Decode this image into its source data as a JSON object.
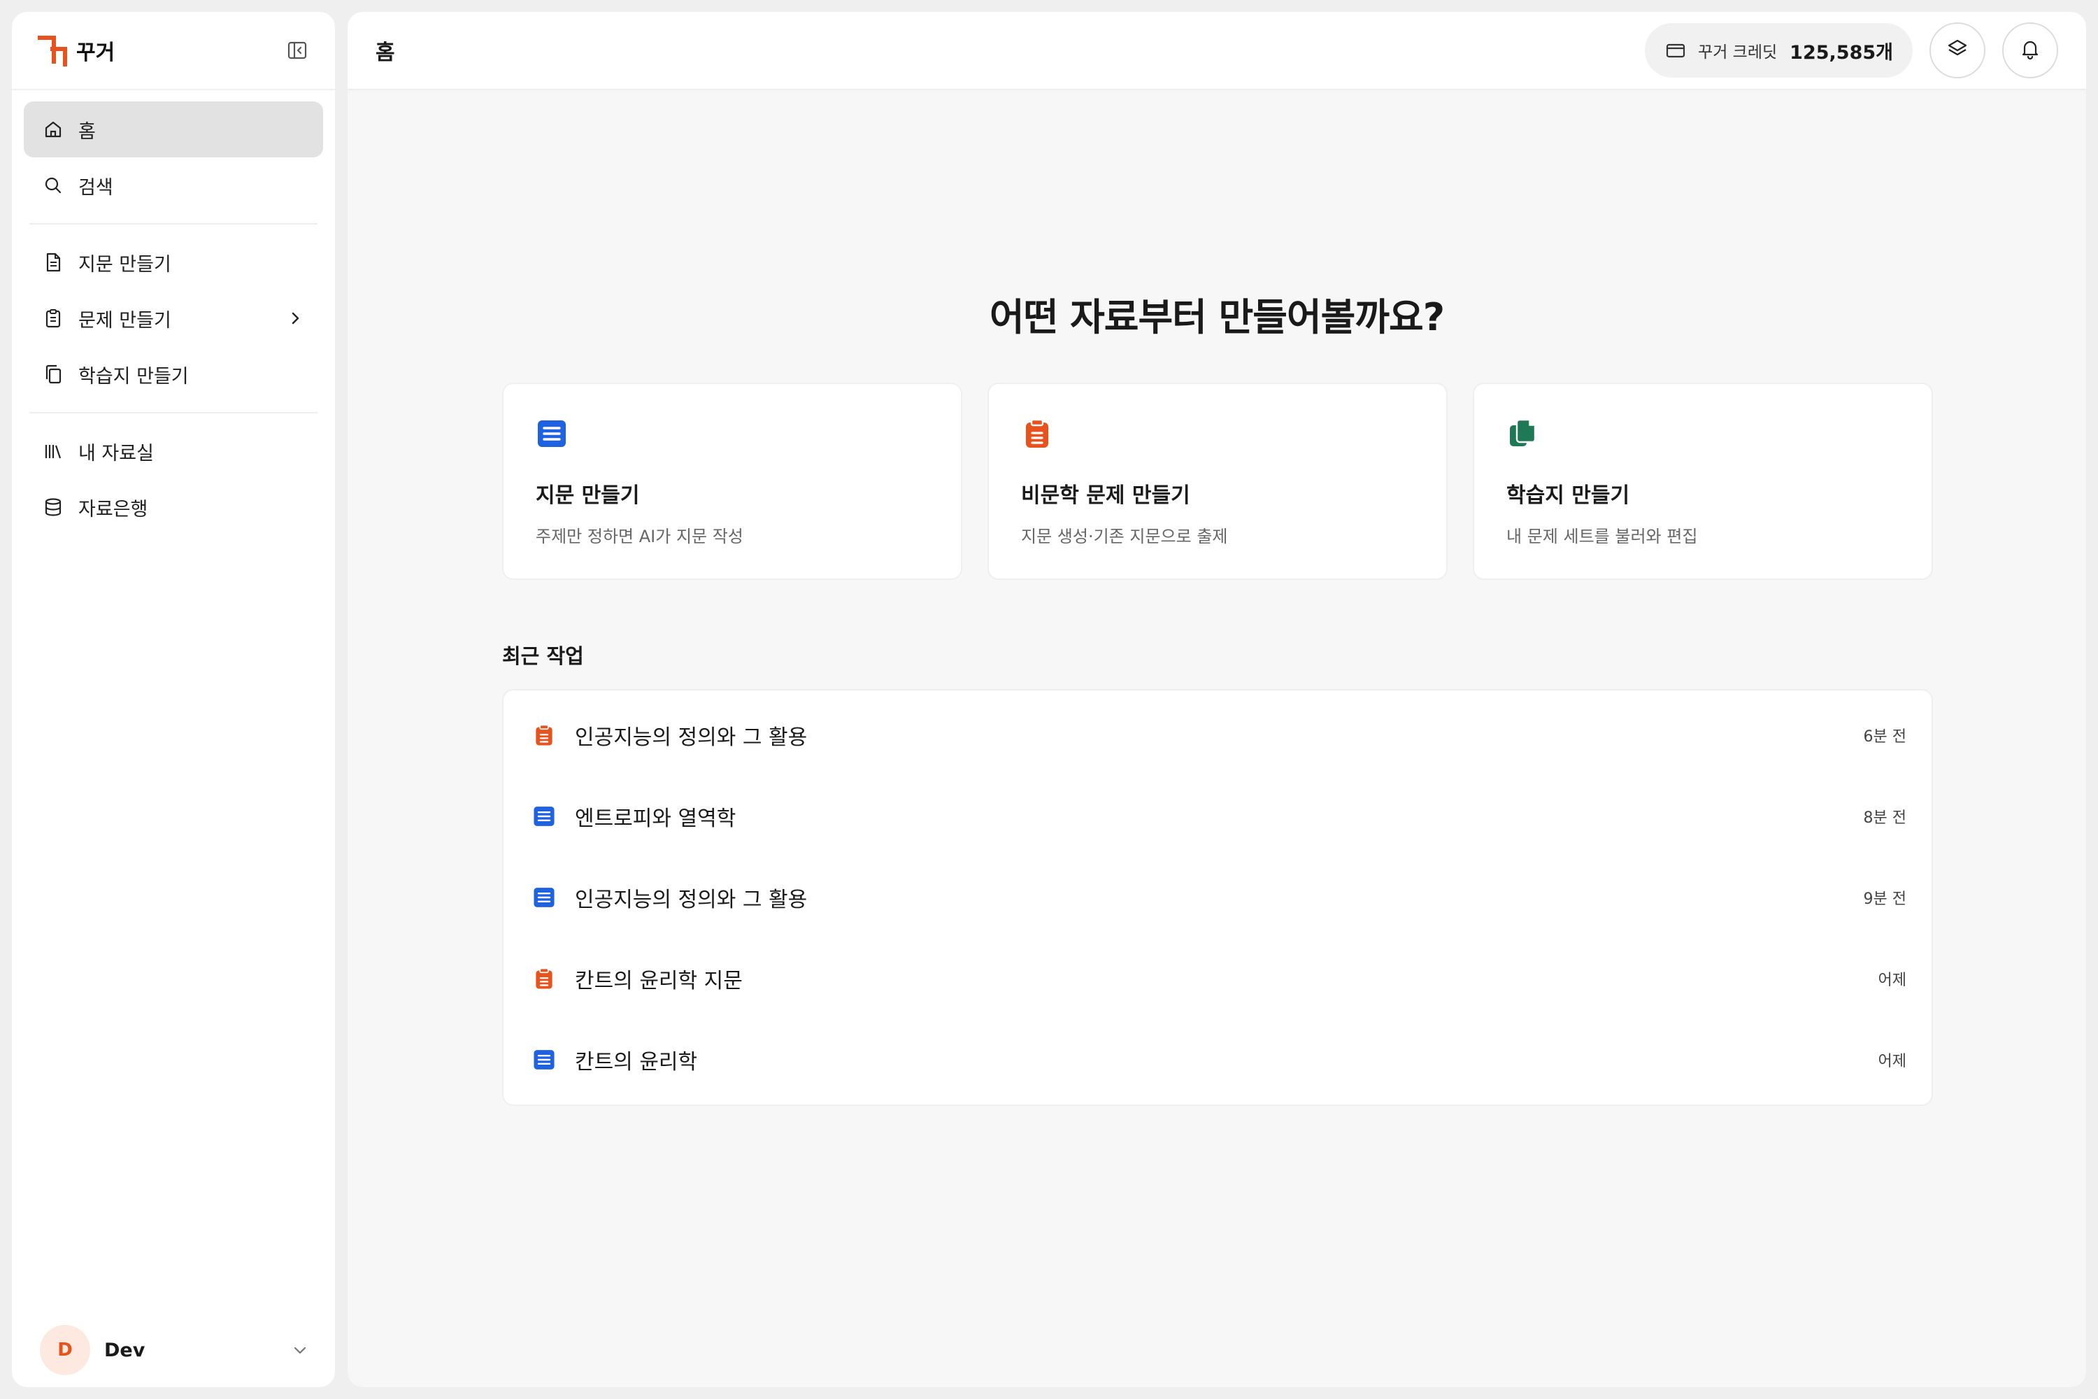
{
  "brand": {
    "name": "꾸거"
  },
  "colors": {
    "accent_orange": "#e8521d",
    "accent_blue": "#1f62e0",
    "accent_green": "#1e7a56"
  },
  "sidebar": {
    "items": [
      {
        "label": "홈",
        "icon": "home-icon"
      },
      {
        "label": "검색",
        "icon": "search-icon"
      },
      {
        "label": "지문 만들기",
        "icon": "document-icon"
      },
      {
        "label": "문제 만들기",
        "icon": "clipboard-icon"
      },
      {
        "label": "학습지 만들기",
        "icon": "copy-icon"
      },
      {
        "label": "내 자료실",
        "icon": "library-icon"
      },
      {
        "label": "자료은행",
        "icon": "database-icon"
      }
    ],
    "user": {
      "initial": "D",
      "name": "Dev"
    }
  },
  "header": {
    "title": "홈",
    "credit_label": "꾸거 크레딧",
    "credit_value": "125,585개"
  },
  "main": {
    "headline": "어떤 자료부터 만들어볼까요?",
    "cards": [
      {
        "title": "지문 만들기",
        "desc": "주제만 정하면 AI가 지문 작성",
        "icon": "document-list-icon"
      },
      {
        "title": "비문학 문제 만들기",
        "desc": "지문 생성·기존 지문으로 출제",
        "icon": "clipboard-icon"
      },
      {
        "title": "학습지 만들기",
        "desc": "내 문제 세트를 불러와 편집",
        "icon": "copy-icon"
      }
    ],
    "recent_title": "최근 작업",
    "recent": [
      {
        "title": "인공지능의 정의와 그 활용",
        "time": "6분 전",
        "type": "clipboard"
      },
      {
        "title": "엔트로피와 열역학",
        "time": "8분 전",
        "type": "document"
      },
      {
        "title": "인공지능의 정의와 그 활용",
        "time": "9분 전",
        "type": "document"
      },
      {
        "title": "칸트의 윤리학 지문",
        "time": "어제",
        "type": "clipboard"
      },
      {
        "title": "칸트의 윤리학",
        "time": "어제",
        "type": "document"
      }
    ]
  }
}
